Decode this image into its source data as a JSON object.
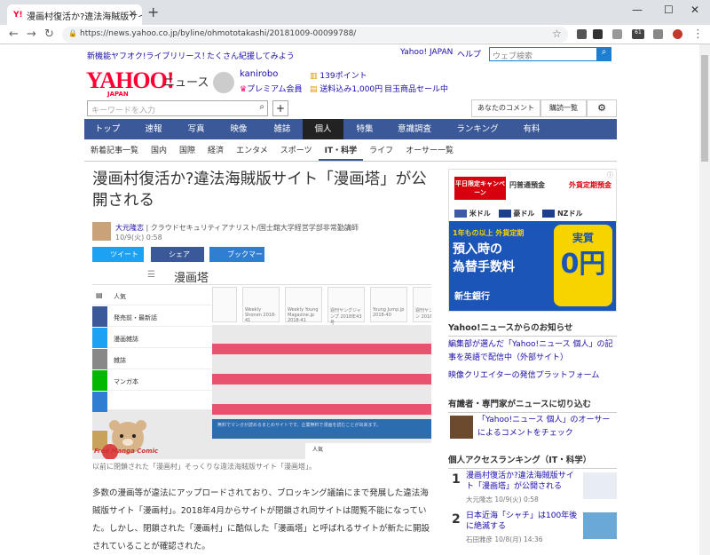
{
  "browser": {
    "tab_title": "漫画村復活か?違法海賊版サイト",
    "url": "https://news.yahoo.co.jp/byline/ohmototakashi/20181009-00099788/",
    "ext_badge": "61"
  },
  "header": {
    "promo1": "新機能ヤフオク!ライブリリース！",
    "promo2": "たくさん紀援してみよう",
    "yahoo_japan": "Yahoo! JAPAN",
    "help": "ヘルプ",
    "search_placeholder": "ウェブ検索",
    "logo": "YAHOO!",
    "logo_sub": "JAPAN",
    "news_label": "ニュース",
    "username": "kanirobo",
    "premium": "プレミアム会員",
    "points": "139ポイント",
    "shipping": "送料込み1,000円",
    "sale": "目玉商品セール中",
    "keyword_placeholder": "キーワードを入力",
    "comments_btn": "あなたのコメント",
    "list_btn": "購読一覧"
  },
  "global_nav": [
    "トップ",
    "速報",
    "写真",
    "映像",
    "雑誌",
    "個人",
    "特集",
    "意識調査",
    "ランキング",
    "有料"
  ],
  "sub_nav": [
    "新着記事一覧",
    "国内",
    "国際",
    "経済",
    "エンタメ",
    "スポーツ",
    "IT・科学",
    "ライフ",
    "オーサー一覧"
  ],
  "article": {
    "title": "漫画村復活か?違法海賊版サイト「漫画塔」が公開される",
    "author": "大元隆志",
    "author_desc": "クラウドセキュリティアナリスト/国士舘大学経営学部非常勤講師",
    "date": "10/9(火) 0:58",
    "share": [
      "ツイート",
      "シェア",
      "ブックマーク"
    ],
    "caption": "以前に閉鎖された「漫画村」そっくりな違法海賊版サイト「漫画塔」。",
    "body": "多数の漫画等が違法にアップロードされており、ブロッキング議論にまで発展した違法海賊版サイト「漫画村」。2018年4月からサイトが閉鎖され同サイトは閲覧不能になっていた。しかし、閉鎖された「漫画村」に酷似した「漫画塔」と呼ばれるサイトが新たに開設されていることが確認された。"
  },
  "figure": {
    "site_title": "漫画塔",
    "menu": [
      "人気",
      "発売前・最新話",
      "漫画雑誌",
      "雑誌",
      "マンガ本"
    ],
    "thumbs": [
      "Weekly Shonen 2018-41",
      "Weekly Young Magazine.jp 2018-41",
      "週刊ヤングジャンプ 2018年43号",
      "Young Jump.jp 2018-40",
      "週刊ヤングジャン 2018-41"
    ],
    "footer_text": "無料でマンガが読めるまとめサイトです。企業無料で漫画を読むことが出来ます。",
    "free_manga": "Free Manga Comic",
    "row_label": "人気"
  },
  "ad": {
    "campaign": "平日限定キャンペーン",
    "yen": "円普通預金",
    "dollar": "外貨定期預金",
    "usd": "米ドル",
    "aud": "豪ドル",
    "nzd": "NZドル",
    "headline1": "1年もの以上 外貨定期",
    "headline2": "預入時の",
    "headline3": "為替手数料",
    "jitsushitsu": "実質",
    "zero": "0円",
    "bank": "新生銀行"
  },
  "sidebar": {
    "notice_title": "Yahoo!ニュースからのお知らせ",
    "notice_links": [
      "編集部が選んだ「Yahoo!ニュース 個人」の記事を英語で配信中（外部サイト）",
      "映像クリエイターの発信プラットフォーム"
    ],
    "expert_title": "有識者・専門家がニュースに切り込む",
    "expert_text": "「Yahoo!ニュース 個人」のオーサーによるコメントをチェック",
    "ranking_title": "個人アクセスランキング（IT・科学）",
    "ranking": [
      {
        "n": "1",
        "title": "漫画村復活か?違法海賊版サイト「漫画塔」が公開される",
        "by": "大元隆志 10/9(火) 0:58"
      },
      {
        "n": "2",
        "title": "日本近海「シャチ」は100年後に絶滅する",
        "by": "石田雅彦 10/8(月) 14:36"
      }
    ]
  }
}
